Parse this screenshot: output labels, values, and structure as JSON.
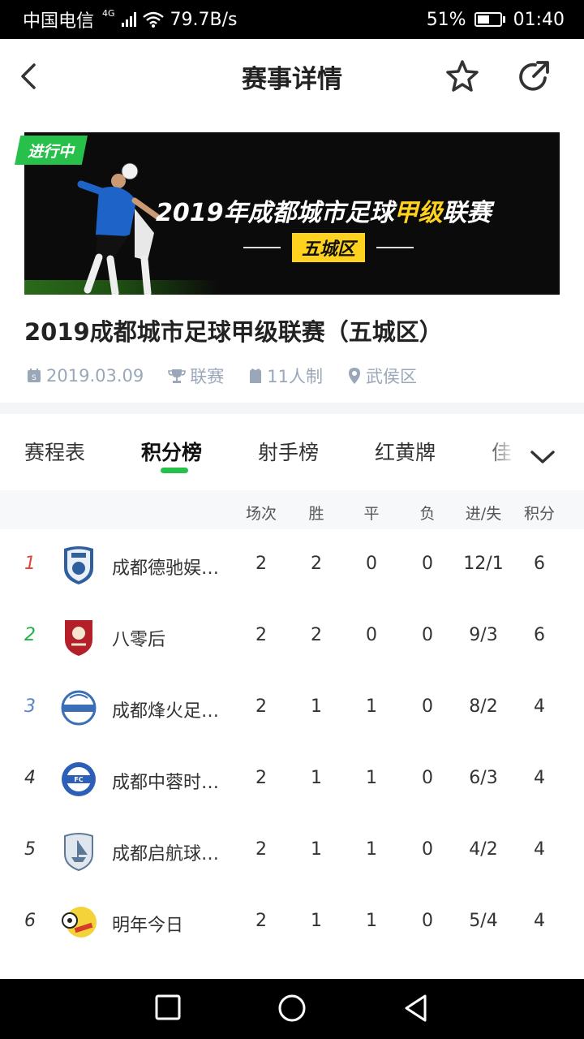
{
  "status_bar": {
    "carrier": "中国电信",
    "network": "4G",
    "speed": "79.7B/s",
    "battery": "51%",
    "time": "01:40"
  },
  "header": {
    "title": "赛事详情",
    "icons": [
      "back-arrow-icon",
      "star-icon",
      "share-icon"
    ]
  },
  "banner": {
    "status_tag": "进行中",
    "title_part1": "2019年成都城市足球",
    "title_highlight": "甲级",
    "title_part2": "联赛",
    "subtitle": "五城区"
  },
  "match": {
    "title": "2019成都城市足球甲级联赛（五城区）",
    "date": "2019.03.09",
    "type": "联赛",
    "format": "11人制",
    "location": "武侯区"
  },
  "tabs": [
    {
      "label": "赛程表",
      "active": false
    },
    {
      "label": "积分榜",
      "active": true
    },
    {
      "label": "射手榜",
      "active": false
    },
    {
      "label": "红黄牌",
      "active": false
    },
    {
      "label": "佳",
      "active": false
    }
  ],
  "table": {
    "headers": [
      "场次",
      "胜",
      "平",
      "负",
      "进/失",
      "积分"
    ],
    "rows": [
      {
        "rank": "1",
        "rank_color": "#e0463a",
        "name": "成都德驰娱…",
        "played": "2",
        "win": "2",
        "draw": "0",
        "loss": "0",
        "goals": "12/1",
        "points": "6"
      },
      {
        "rank": "2",
        "rank_color": "#26b04a",
        "name": "八零后",
        "played": "2",
        "win": "2",
        "draw": "0",
        "loss": "0",
        "goals": "9/3",
        "points": "6"
      },
      {
        "rank": "3",
        "rank_color": "#5a86c8",
        "name": "成都烽火足…",
        "played": "2",
        "win": "1",
        "draw": "1",
        "loss": "0",
        "goals": "8/2",
        "points": "4"
      },
      {
        "rank": "4",
        "rank_color": "#333333",
        "name": "成都中蓉时…",
        "played": "2",
        "win": "1",
        "draw": "1",
        "loss": "0",
        "goals": "6/3",
        "points": "4"
      },
      {
        "rank": "5",
        "rank_color": "#333333",
        "name": "成都启航球…",
        "played": "2",
        "win": "1",
        "draw": "1",
        "loss": "0",
        "goals": "4/2",
        "points": "4"
      },
      {
        "rank": "6",
        "rank_color": "#333333",
        "name": "明年今日",
        "played": "2",
        "win": "1",
        "draw": "1",
        "loss": "0",
        "goals": "5/4",
        "points": "4"
      }
    ]
  },
  "colors": {
    "accent": "#26c04a",
    "banner_highlight": "#ffd21f",
    "info_text": "#9aa7b8"
  }
}
